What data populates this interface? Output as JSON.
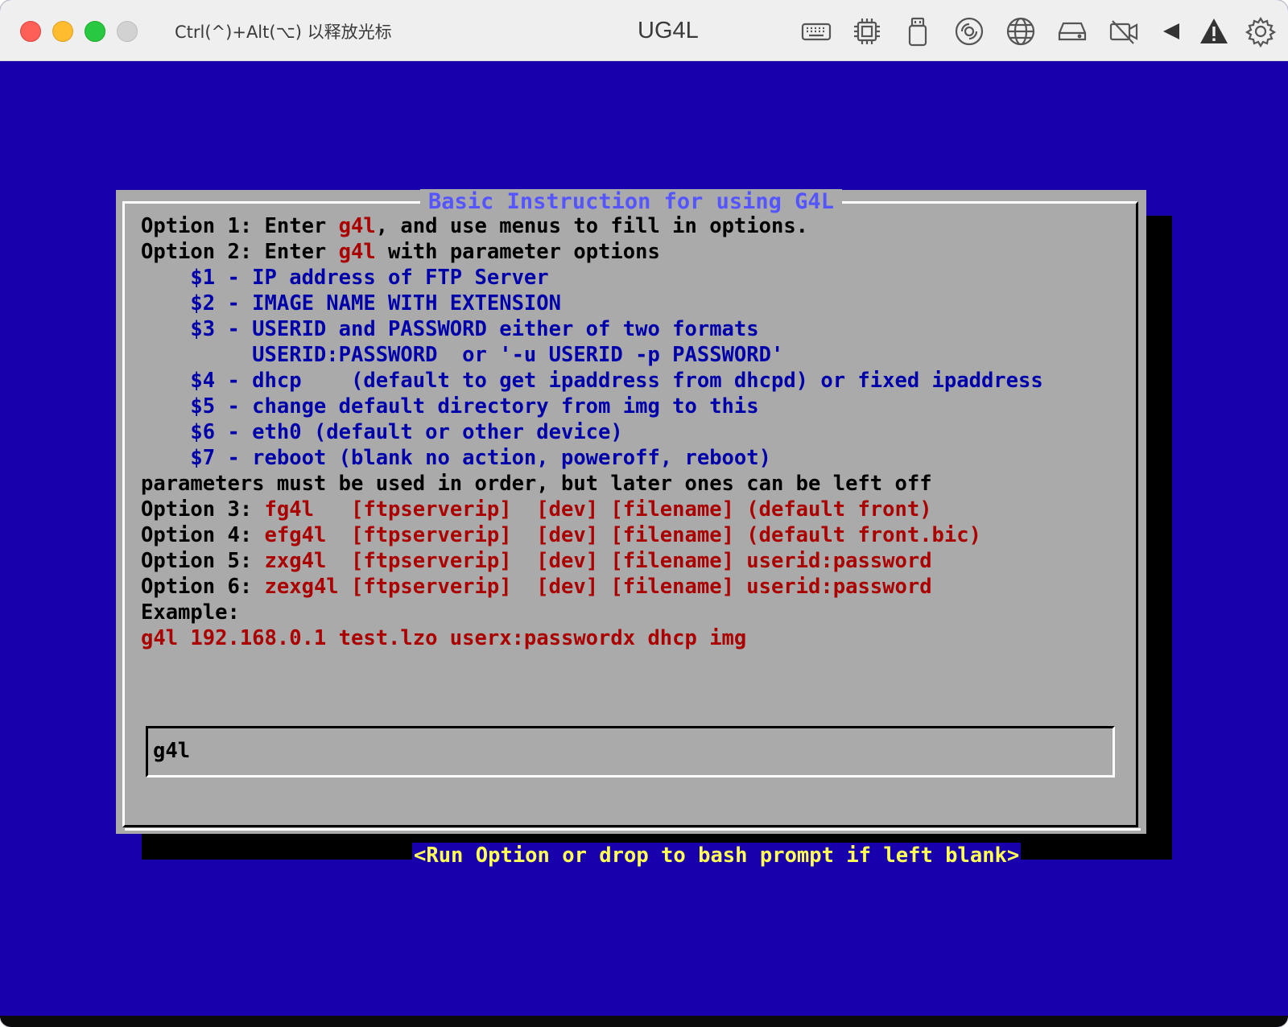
{
  "window": {
    "title": "UG4L",
    "release_hint": "Ctrl(^)+Alt(⌥) 以释放光标"
  },
  "toolbar_icons": [
    "keyboard-icon",
    "cpu-icon",
    "usb-drive-icon",
    "disc-icon",
    "network-globe-icon",
    "hard-drive-icon",
    "camera-off-icon",
    "audio-icon",
    "warning-icon",
    "gear-icon"
  ],
  "colors": {
    "console_bg": "#1800ac",
    "dialog_bg": "#aaaaaa",
    "title_blue": "#5555ff",
    "text_blue": "#0000aa",
    "text_red": "#aa0000",
    "button_text": "#ffff55"
  },
  "dialog": {
    "title": "Basic Instruction for using G4L",
    "lines": [
      [
        {
          "t": "Option 1: Enter ",
          "c": "blk"
        },
        {
          "t": "g4l",
          "c": "red"
        },
        {
          "t": ", and use menus to fill in options.",
          "c": "blk"
        }
      ],
      [
        {
          "t": "Option 2: Enter ",
          "c": "blk"
        },
        {
          "t": "g4l",
          "c": "red"
        },
        {
          "t": " with parameter options",
          "c": "blk"
        }
      ],
      [
        {
          "t": "    $1 - IP address of FTP Server",
          "c": "blu"
        }
      ],
      [
        {
          "t": "    $2 - IMAGE NAME WITH EXTENSION",
          "c": "blu"
        }
      ],
      [
        {
          "t": "    $3 - USERID and PASSWORD either of two formats",
          "c": "blu"
        }
      ],
      [
        {
          "t": "         USERID:PASSWORD  or '-u USERID -p PASSWORD'",
          "c": "blu"
        }
      ],
      [
        {
          "t": "    $4 - dhcp    (default to get ipaddress from dhcpd) or fixed ipaddress",
          "c": "blu"
        }
      ],
      [
        {
          "t": "    $5 - change default directory from img to this",
          "c": "blu"
        }
      ],
      [
        {
          "t": "    $6 - eth0 (default or other device)",
          "c": "blu"
        }
      ],
      [
        {
          "t": "    $7 - reboot (blank no action, poweroff, reboot)",
          "c": "blu"
        }
      ],
      [
        {
          "t": "parameters must be used in order, but later ones can be left off",
          "c": "blk"
        }
      ],
      [
        {
          "t": "Option 3: ",
          "c": "blk"
        },
        {
          "t": "fg4l   [ftpserverip]  [dev] [filename] (default front)",
          "c": "red"
        }
      ],
      [
        {
          "t": "Option 4: ",
          "c": "blk"
        },
        {
          "t": "efg4l  [ftpserverip]  [dev] [filename] (default front.bic)",
          "c": "red"
        }
      ],
      [
        {
          "t": "Option 5: ",
          "c": "blk"
        },
        {
          "t": "zxg4l  [ftpserverip]  [dev] [filename] userid:password",
          "c": "red"
        }
      ],
      [
        {
          "t": "Option 6: ",
          "c": "blk"
        },
        {
          "t": "zexg4l [ftpserverip]  [dev] [filename] userid:password",
          "c": "red"
        }
      ],
      [
        {
          "t": "Example:",
          "c": "blk"
        }
      ],
      [
        {
          "t": "g4l 192.168.0.1 test.lzo userx:passwordx dhcp img",
          "c": "red"
        }
      ]
    ],
    "input_value": "g4l",
    "button_label": "<Run Option or drop to bash prompt if left blank>"
  }
}
